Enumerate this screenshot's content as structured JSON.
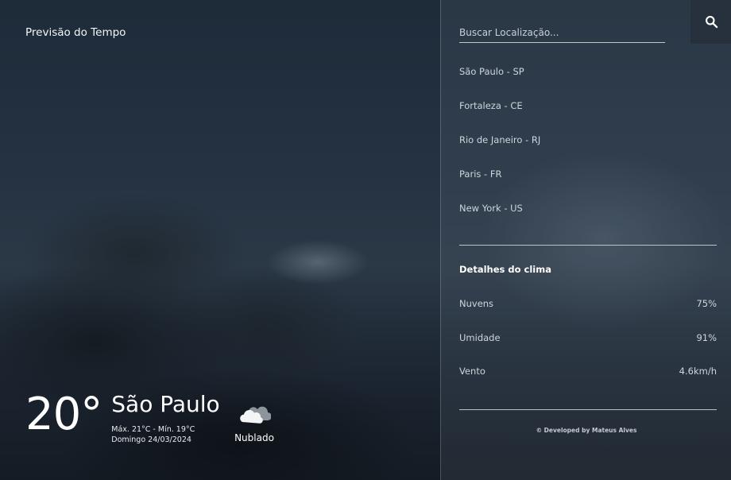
{
  "app": {
    "title": "Previsão do Tempo"
  },
  "current": {
    "temperature": "20°",
    "city": "São Paulo",
    "minmax": "Máx. 21°C - Mín. 19°C",
    "date": "Domingo 24/03/2024",
    "condition": "Nublado",
    "condition_icon": "cloud-icon"
  },
  "search": {
    "placeholder": "Buscar Localização...",
    "value": "",
    "button_icon": "search-icon"
  },
  "locations": [
    "São Paulo - SP",
    "Fortaleza - CE",
    "Rio de Janeiro - RJ",
    "Paris - FR",
    "New York - US"
  ],
  "details": {
    "title": "Detalhes do clima",
    "rows": [
      {
        "label": "Nuvens",
        "value": "75%"
      },
      {
        "label": "Umidade",
        "value": "91%"
      },
      {
        "label": "Vento",
        "value": "4.6km/h"
      }
    ]
  },
  "footer": {
    "credit": "© Developed by Mateus Alves"
  },
  "colors": {
    "panel_overlay": "#78849224",
    "search_button_bg": "#26313d",
    "divider": "#b9c1c9"
  }
}
